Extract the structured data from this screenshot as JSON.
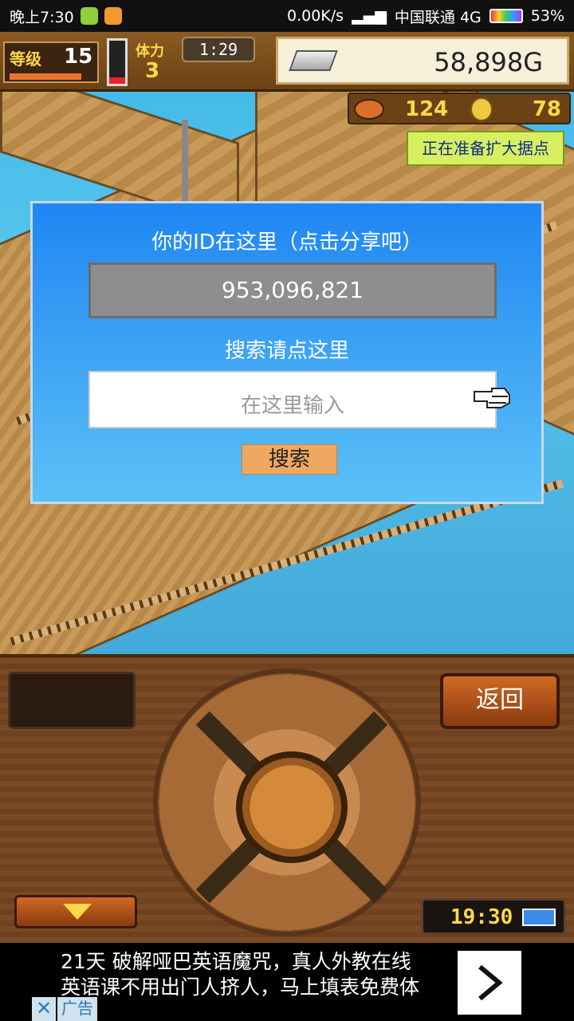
{
  "status_bar": {
    "time": "晚上7:30",
    "network_speed": "0.00K/s",
    "carrier": "中国联通 4G",
    "battery": "53%"
  },
  "hud": {
    "level_label": "等级",
    "level": "15",
    "stamina_label": "体力",
    "stamina": "3",
    "timer": "1:29",
    "money": "58,898G",
    "resource_a": "124",
    "resource_b": "78",
    "expand_banner": "正在准备扩大据点"
  },
  "dialog": {
    "title": "你的ID在这里（点击分享吧）",
    "player_id": "953,096,821",
    "search_hint": "搜索请点这里",
    "search_placeholder": "在这里输入",
    "search_button": "搜索"
  },
  "panel": {
    "back_button": "返回",
    "clock": "19:30"
  },
  "ad": {
    "line1": "21天 破解哑巴英语魔咒，真人外教在线",
    "line2": "英语课不用出门人挤人，马上填表免费体",
    "close_symbol": "✕",
    "tag": "广告"
  }
}
